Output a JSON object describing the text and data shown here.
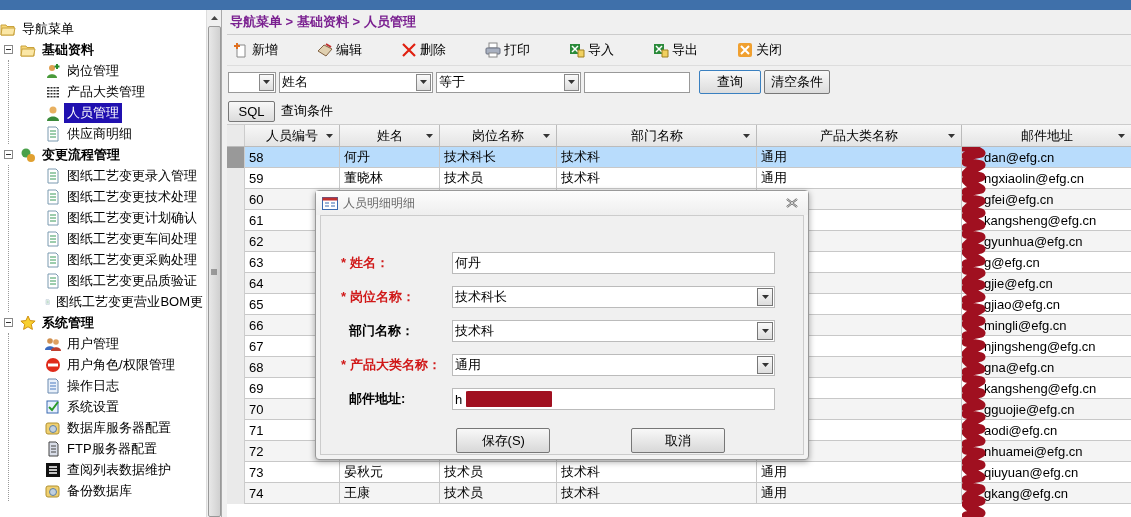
{
  "sidebar": {
    "title": "导航菜单",
    "groups": [
      {
        "label": "基础资料",
        "kind": "folder",
        "expanded": true,
        "children": [
          {
            "label": "岗位管理",
            "kind": "user-plus",
            "selected": false
          },
          {
            "label": "产品大类管理",
            "kind": "grid",
            "selected": false
          },
          {
            "label": "人员管理",
            "kind": "person",
            "selected": true
          },
          {
            "label": "供应商明细",
            "kind": "doc",
            "selected": false
          }
        ]
      },
      {
        "label": "变更流程管理",
        "kind": "flow",
        "expanded": true,
        "children": [
          {
            "label": "图纸工艺变更录入管理",
            "kind": "doc",
            "selected": false
          },
          {
            "label": "图纸工艺变更技术处理",
            "kind": "doc",
            "selected": false
          },
          {
            "label": "图纸工艺变更计划确认",
            "kind": "doc",
            "selected": false
          },
          {
            "label": "图纸工艺变更车间处理",
            "kind": "doc",
            "selected": false
          },
          {
            "label": "图纸工艺变更采购处理",
            "kind": "doc",
            "selected": false
          },
          {
            "label": "图纸工艺变更品质验证",
            "kind": "doc",
            "selected": false
          },
          {
            "label": "图纸工艺变更营业BOM更",
            "kind": "doc",
            "selected": false
          }
        ]
      },
      {
        "label": "系统管理",
        "kind": "star",
        "expanded": true,
        "children": [
          {
            "label": "用户管理",
            "kind": "users",
            "selected": false
          },
          {
            "label": "用户角色/权限管理",
            "kind": "stop",
            "selected": false
          },
          {
            "label": "操作日志",
            "kind": "log",
            "selected": false
          },
          {
            "label": "系统设置",
            "kind": "settings",
            "selected": false
          },
          {
            "label": "数据库服务器配置",
            "kind": "db",
            "selected": false
          },
          {
            "label": "FTP服务器配置",
            "kind": "server",
            "selected": false
          },
          {
            "label": "查阅列表数据维护",
            "kind": "list",
            "selected": false
          },
          {
            "label": "备份数据库",
            "kind": "db",
            "selected": false
          }
        ]
      }
    ]
  },
  "breadcrumb": "导航菜单 > 基础资料 > 人员管理",
  "toolbar": [
    {
      "label": "新增",
      "kind": "new"
    },
    {
      "label": "编辑",
      "kind": "edit"
    },
    {
      "label": "删除",
      "kind": "delete"
    },
    {
      "label": "打印",
      "kind": "print"
    },
    {
      "label": "导入",
      "kind": "import"
    },
    {
      "label": "导出",
      "kind": "export"
    },
    {
      "label": "关闭",
      "kind": "close"
    }
  ],
  "filter": {
    "field": "姓名",
    "operator": "等于",
    "search_button": "查询",
    "clear_button": "清空条件",
    "sql_button": "SQL",
    "condition": "查询条件"
  },
  "table": {
    "columns": [
      "人员编号",
      "姓名",
      "岗位名称",
      "部门名称",
      "产品大类名称",
      "邮件地址"
    ],
    "rows": [
      {
        "selected": true,
        "cells": [
          "58",
          "何丹",
          "技术科长",
          "技术科",
          "通用",
          "dan@efg.cn"
        ]
      },
      {
        "selected": false,
        "cells": [
          "59",
          "董晓林",
          "技术员",
          "技术科",
          "通用",
          "ngxiaolin@efg.cn"
        ]
      },
      {
        "selected": false,
        "cells": [
          "60",
          null,
          null,
          null,
          null,
          "gfei@efg.cn"
        ]
      },
      {
        "selected": false,
        "cells": [
          "61",
          null,
          null,
          null,
          null,
          "kangsheng@efg.cn"
        ]
      },
      {
        "selected": false,
        "cells": [
          "62",
          null,
          null,
          null,
          null,
          "gyunhua@efg.cn"
        ]
      },
      {
        "selected": false,
        "cells": [
          "63",
          null,
          null,
          null,
          null,
          "g@efg.cn"
        ]
      },
      {
        "selected": false,
        "cells": [
          "64",
          null,
          null,
          null,
          null,
          "gjie@efg.cn"
        ]
      },
      {
        "selected": false,
        "cells": [
          "65",
          null,
          null,
          null,
          null,
          "gjiao@efg.cn"
        ]
      },
      {
        "selected": false,
        "cells": [
          "66",
          null,
          null,
          null,
          null,
          "mingli@efg.cn"
        ]
      },
      {
        "selected": false,
        "cells": [
          "67",
          null,
          null,
          null,
          null,
          "njingsheng@efg.cn"
        ]
      },
      {
        "selected": false,
        "cells": [
          "68",
          null,
          null,
          null,
          null,
          "gna@efg.cn"
        ]
      },
      {
        "selected": false,
        "cells": [
          "69",
          null,
          null,
          null,
          null,
          "kangsheng@efg.cn"
        ]
      },
      {
        "selected": false,
        "cells": [
          "70",
          null,
          null,
          null,
          null,
          "gguojie@efg.cn"
        ]
      },
      {
        "selected": false,
        "cells": [
          "71",
          null,
          null,
          null,
          null,
          "aodi@efg.cn"
        ]
      },
      {
        "selected": false,
        "cells": [
          "72",
          null,
          null,
          null,
          null,
          "nhuamei@efg.cn"
        ]
      },
      {
        "selected": false,
        "cells": [
          "73",
          "晏秋元",
          "技术员",
          "技术科",
          "通用",
          "qiuyuan@efg.cn"
        ]
      },
      {
        "selected": false,
        "cells": [
          "74",
          "王康",
          "技术员",
          "技术科",
          "通用",
          "gkang@efg.cn"
        ]
      }
    ]
  },
  "dialog": {
    "title": "人员明细明细",
    "fields": [
      {
        "label": "* 姓名：",
        "required": true,
        "kind": "text",
        "value": "何丹"
      },
      {
        "label": "* 岗位名称：",
        "required": true,
        "kind": "select",
        "value": "技术科长"
      },
      {
        "label": "部门名称：",
        "required": false,
        "kind": "select",
        "value": "技术科"
      },
      {
        "label": "* 产品大类名称：",
        "required": true,
        "kind": "select",
        "value": "通用"
      },
      {
        "label": "邮件地址:",
        "required": false,
        "kind": "redacted",
        "value": "h"
      }
    ],
    "buttons": [
      "保存(S)",
      "取消"
    ]
  }
}
